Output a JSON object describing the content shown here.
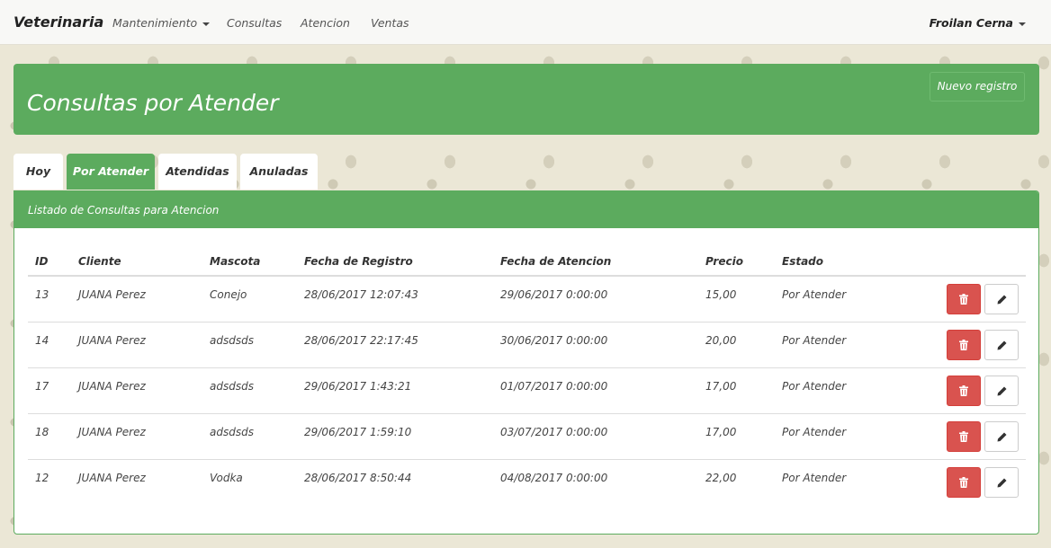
{
  "navbar": {
    "brand": "Veterinaria",
    "items": [
      "Mantenimiento",
      "Consultas",
      "Atencion",
      "Ventas"
    ],
    "user": "Froilan Cerna"
  },
  "header": {
    "title": "Consultas por Atender",
    "new_button": "Nuevo registro"
  },
  "tabs": [
    "Hoy",
    "Por Atender",
    "Atendidas",
    "Anuladas"
  ],
  "active_tab": "Por Atender",
  "panel": {
    "heading": "Listado de Consultas para Atencion",
    "columns": [
      "ID",
      "Cliente",
      "Mascota",
      "Fecha de Registro",
      "Fecha de Atencion",
      "Precio",
      "Estado"
    ],
    "rows": [
      {
        "id": "13",
        "cliente": "JUANA Perez",
        "mascota": "Conejo",
        "registro": "28/06/2017 12:07:43",
        "atencion": "29/06/2017 0:00:00",
        "precio": "15,00",
        "estado": "Por Atender"
      },
      {
        "id": "14",
        "cliente": "JUANA Perez",
        "mascota": "adsdsds",
        "registro": "28/06/2017 22:17:45",
        "atencion": "30/06/2017 0:00:00",
        "precio": "20,00",
        "estado": "Por Atender"
      },
      {
        "id": "17",
        "cliente": "JUANA Perez",
        "mascota": "adsdsds",
        "registro": "29/06/2017 1:43:21",
        "atencion": "01/07/2017 0:00:00",
        "precio": "17,00",
        "estado": "Por Atender"
      },
      {
        "id": "18",
        "cliente": "JUANA Perez",
        "mascota": "adsdsds",
        "registro": "29/06/2017 1:59:10",
        "atencion": "03/07/2017 0:00:00",
        "precio": "17,00",
        "estado": "Por Atender"
      },
      {
        "id": "12",
        "cliente": "JUANA Perez",
        "mascota": "Vodka",
        "registro": "28/06/2017 8:50:44",
        "atencion": "04/08/2017 0:00:00",
        "precio": "22,00",
        "estado": "Por Atender"
      }
    ]
  },
  "colors": {
    "accent": "#5cab5e",
    "danger": "#d9534f",
    "background": "#ebe7d6"
  },
  "icons": {
    "delete": "trash-icon",
    "edit": "pencil-icon",
    "dropdown": "caret-down-icon"
  }
}
